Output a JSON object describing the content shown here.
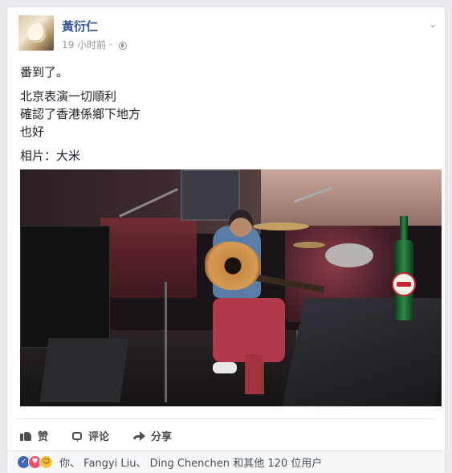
{
  "post": {
    "author": "黃衍仁",
    "time": "19 小时前",
    "time_separator": "·",
    "privacy_icon": "globe-icon",
    "menu_icon": "chevron-down-icon",
    "text": {
      "line1": "番到了。",
      "line2": "北京表演一切順利",
      "line3": "確認了香港係鄉下地方",
      "line4": "也好",
      "line5": "相片：大米"
    }
  },
  "actions": {
    "like": "赞",
    "comment": "评论",
    "share": "分享"
  },
  "reactions": {
    "you": "你",
    "separator": "、",
    "person1": "Fangyi Liu",
    "person2": "Ding Chenchen",
    "others": "和其他 120 位用户"
  },
  "colors": {
    "name_blue": "#365899",
    "background": "#e9ebee",
    "bar": "#f6f7f9",
    "like_blue": "#4267b2",
    "love_red": "#f25268"
  }
}
